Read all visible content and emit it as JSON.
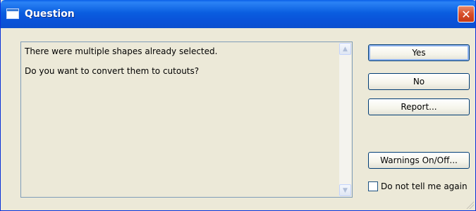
{
  "window": {
    "title": "Question",
    "close_glyph": "✕"
  },
  "message": {
    "line1": "There were multiple shapes already selected.",
    "line2": "Do you want to convert them to cutouts?"
  },
  "buttons": {
    "yes": "Yes",
    "no": "No",
    "report": "Report...",
    "warnings": "Warnings On/Off..."
  },
  "checkbox": {
    "label": "Do not tell me again",
    "checked": false
  },
  "icons": {
    "title_icon": "window-icon",
    "close_icon": "close-icon",
    "scroll_up": "scroll-up-arrow-icon",
    "scroll_down": "scroll-down-arrow-icon"
  },
  "colors": {
    "titlebar": "#0a5ee0",
    "close": "#d84e2a",
    "dialog_bg": "#ece9d8",
    "button_border": "#003c74"
  }
}
